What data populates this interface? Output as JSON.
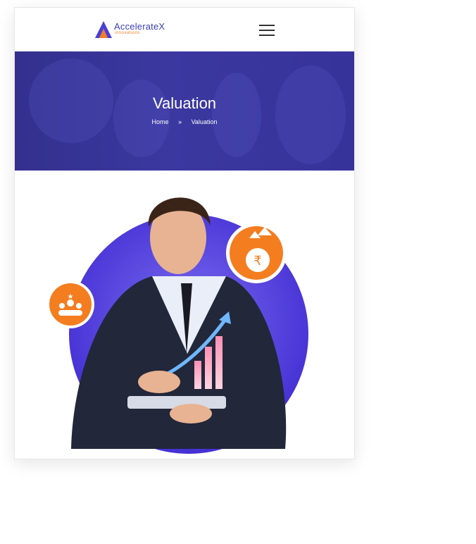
{
  "header": {
    "logo_name": "AccelerateX",
    "logo_sub": "innovations",
    "menu_icon": "hamburger-menu-icon"
  },
  "hero": {
    "title": "Valuation",
    "breadcrumb": {
      "home": "Home",
      "separator_icon": "double-chevron-right-icon",
      "current": "Valuation"
    }
  },
  "illustration": {
    "icons": [
      "rupee-growth-icon",
      "team-star-icon"
    ],
    "colors": {
      "accent_blue": "#4a3fd6",
      "accent_orange": "#f47d20",
      "hero_bg": "#38359c"
    }
  }
}
